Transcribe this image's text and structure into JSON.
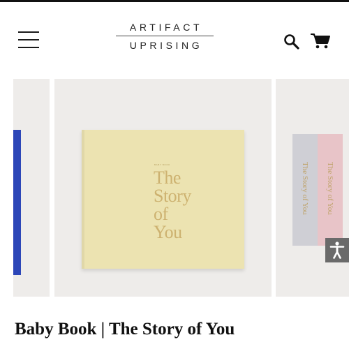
{
  "header": {
    "logo_top": "ARTIFACT",
    "logo_bottom": "UPRISING",
    "menu_icon": "hamburger-menu-icon",
    "search_icon": "search-icon",
    "cart_icon": "shopping-cart-icon"
  },
  "carousel": {
    "main_book": {
      "kicker": "BABY BOOK",
      "title_lines": [
        "The",
        "Story",
        "of",
        "You"
      ],
      "cover_color": "#ece3b1",
      "foil_color": "#cdb270"
    },
    "right_spines": [
      "The Story of You",
      "The Story of You"
    ]
  },
  "accessibility": {
    "icon": "accessibility-icon"
  },
  "product": {
    "title": "Baby Book | The Story of You"
  }
}
